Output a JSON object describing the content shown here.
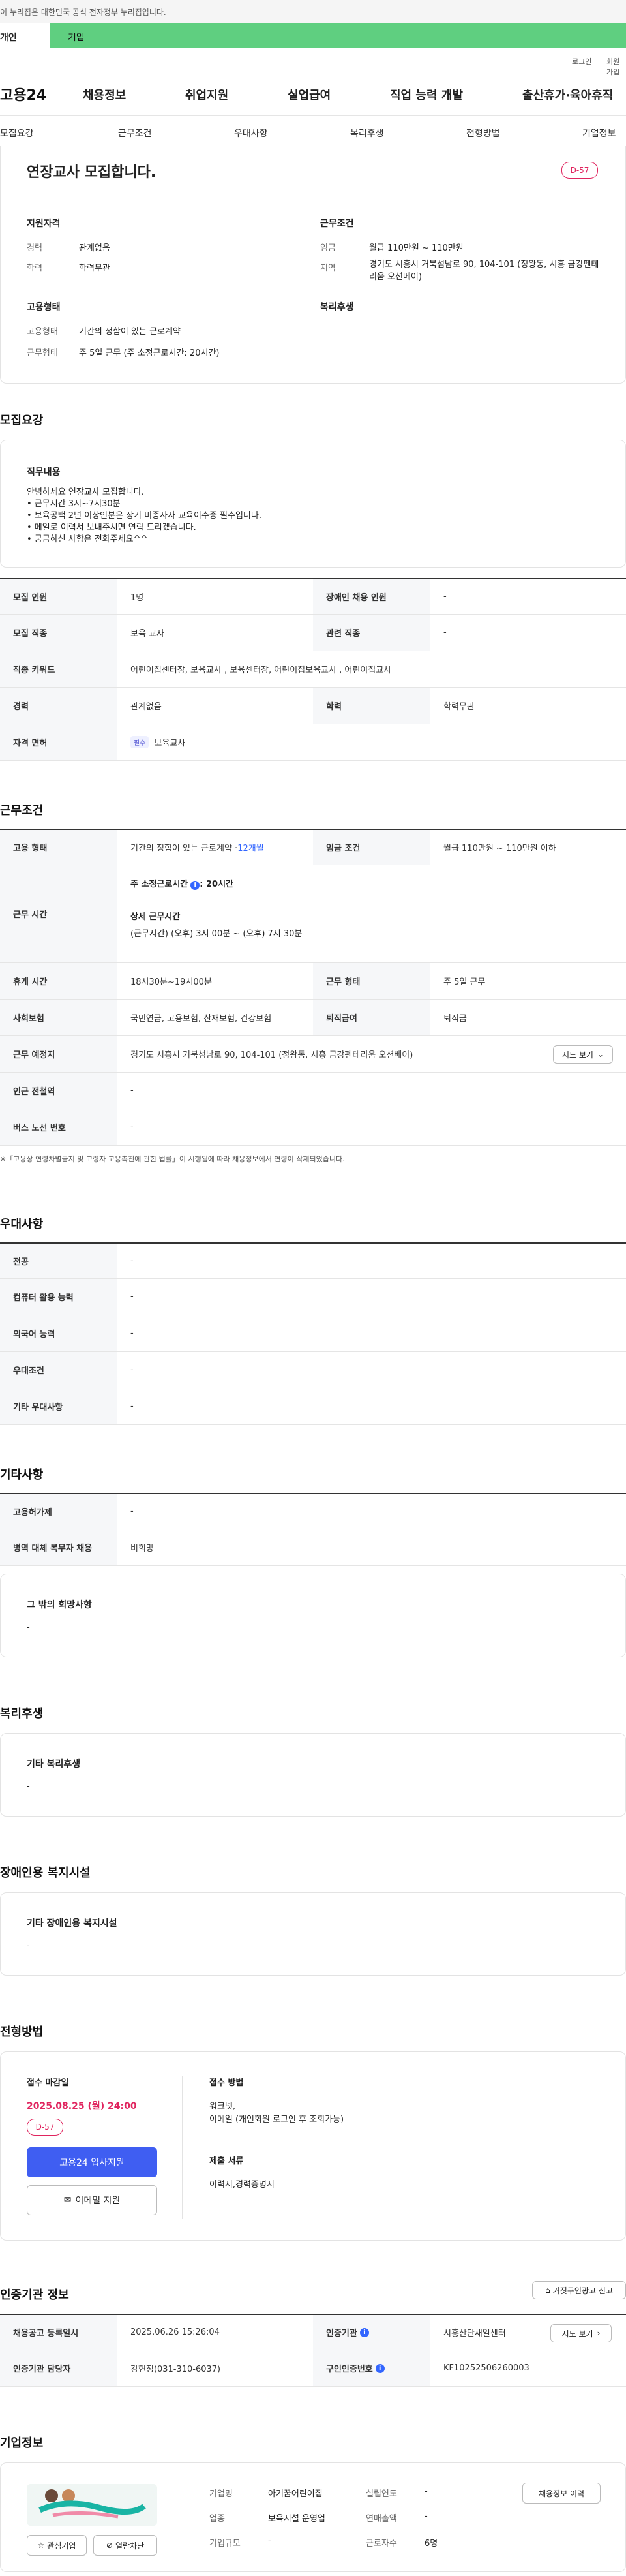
{
  "gov_notice": "이 누리집은 대한민국 공식 전자정부 누리집입니다.",
  "top_tabs": {
    "personal": "개인",
    "company": "기업"
  },
  "util": {
    "login": "로그인",
    "signup": "회원가입"
  },
  "logo": "고용24",
  "gnb": [
    "채용정보",
    "취업지원",
    "실업급여",
    "직업 능력 개발",
    "출산휴가·육아휴직"
  ],
  "snb": [
    "모집요강",
    "근무조건",
    "우대사항",
    "복리후생",
    "전형방법",
    "기업정보"
  ],
  "summary": {
    "title": "연장교사 모집합니다.",
    "dday": "D-57",
    "qual_title": "지원자격",
    "career_label": "경력",
    "career": "관계없음",
    "edu_label": "학력",
    "edu": "학력무관",
    "cond_title": "근무조건",
    "wage_label": "임금",
    "wage": "월급 110만원 ~ 110만원",
    "area_label": "지역",
    "area": "경기도 시흥시 거북섬남로 90, 104-101 (정왕동, 시흥 금강펜테리움 오션베이)",
    "emp_title": "고용형태",
    "emptype_label": "고용형태",
    "emptype": "기간의 정함이 있는 근로계약",
    "worktype_label": "근무형태",
    "worktype": "주 5일 근무 (주 소정근로시간: 20시간)",
    "welfare_title": "복리후생"
  },
  "recruit": {
    "title": "모집요강",
    "duty_title": "직무내용",
    "duty_lines": [
      "안녕하세요 연장교사 모집합니다.",
      "• 근무시간 3시~7시30분",
      "• 보육공백 2년 이상인분은 장기 미종사자 교육이수증 필수입니다.",
      "• 메일로 이력서 보내주시면 연락 드리겠습니다.",
      "• 궁금하신 사항은 전화주세요^^"
    ],
    "rows": [
      {
        "th": "모집 인원",
        "td": "1명",
        "th2": "장애인 채용 인원",
        "td2": "-"
      },
      {
        "th": "모집 직종",
        "td": "보육 교사",
        "th2": "관련 직종",
        "td2": "-"
      },
      {
        "th": "직종 키워드",
        "td": "어린이집센터장, 보육교사 , 보육센터장, 어린이집보육교사 , 어린이집교사"
      },
      {
        "th": "경력",
        "td": "관계없음",
        "th2": "학력",
        "td2": "학력무관"
      }
    ],
    "license_th": "자격 면허",
    "license_tag": "필수",
    "license": "보육교사"
  },
  "work": {
    "title": "근무조건",
    "emp_th": "고용 형태",
    "emp_td": "기간의 정함이 있는 근로계약 · ",
    "emp_months": "12개월",
    "wage_th": "임금 조건",
    "wage_td": "월급 110만원 ~ 110만원 이하",
    "hours_th": "근무 시간",
    "hours_main": "주 소정근로시간",
    "hours_val": ": 20시간",
    "hours_detail_title": "상세 근무시간",
    "hours_detail": "(근무시간) (오후) 3시 00분 ~ (오후) 7시 30분",
    "rest_th": "휴게 시간",
    "rest_td": "18시30분~19시00분",
    "type_th": "근무 형태",
    "type_td": "주 5일 근무",
    "ins_th": "사회보험",
    "ins_td": "국민연금, 고용보험, 산재보험, 건강보험",
    "sev_th": "퇴직급여",
    "sev_td": "퇴직금",
    "place_th": "근무 예정지",
    "place_td": "경기도 시흥시 거북섬남로 90, 104-101 (정왕동, 시흥 금강펜테리움 오션베이)",
    "map_btn": "지도 보기",
    "subway_th": "인근 전철역",
    "subway_td": "-",
    "bus_th": "버스 노선 번호",
    "bus_td": "-",
    "notice": "※「고용상 연령차별금지 및 고령자 고용촉진에 관한 법률」이 시행됨에 따라 채용정보에서 연령이 삭제되었습니다."
  },
  "pref": {
    "title": "우대사항",
    "rows": [
      [
        "전공",
        "-"
      ],
      [
        "컴퓨터 활용 능력",
        "-"
      ],
      [
        "외국어 능력",
        "-"
      ],
      [
        "우대조건",
        "-"
      ],
      [
        "기타 우대사항",
        "-"
      ]
    ]
  },
  "etc": {
    "title": "기타사항",
    "rows": [
      [
        "고용허가제",
        "-"
      ],
      [
        "병역 대체 복무자 채용",
        "비희망"
      ]
    ],
    "hope_title": "그 밖의 희망사항",
    "hope": "-"
  },
  "welfare": {
    "title": "복리후생",
    "box_title": "기타 복리후생",
    "box": "-"
  },
  "disabled": {
    "title": "장애인용 복지시설",
    "box_title": "기타 장애인용 복지시설",
    "box": "-"
  },
  "selection": {
    "title": "전형방법",
    "deadline_title": "접수 마감일",
    "deadline": "2025.08.25 (월) 24:00",
    "dday": "D-57",
    "apply_btn": "고용24 입사지원",
    "email_btn": "이메일 지원",
    "method_title": "접수 방법",
    "method_lines": [
      "워크넷,",
      "이메일 (개인회원 로그인 후 조회가능)"
    ],
    "docs_title": "제출 서류",
    "docs": "이력서,경력증명서"
  },
  "cert": {
    "title": "인증기관 정보",
    "report_btn": "거짓구인광고 신고",
    "reg_th": "채용공고 등록일시",
    "reg_td": "2025.06.26 15:26:04",
    "org_th": "인증기관",
    "org_td": "시흥산단새일센터",
    "map_btn": "지도 보기",
    "mgr_th": "인증기관 담당자",
    "mgr_td": "강현정(031-310-6037)",
    "no_th": "구인인증번호",
    "no_td": "KF10252506260003"
  },
  "company": {
    "title": "기업정보",
    "history_btn": "채용정보 이력",
    "fav_btn": "관심기업",
    "block_btn": "열람차단",
    "name_label": "기업명",
    "name": "아기꿈어린이집",
    "est_label": "설립연도",
    "est": "-",
    "industry_label": "업종",
    "industry": "보육시설 운영업",
    "sales_label": "연매출액",
    "sales": "-",
    "size_label": "기업규모",
    "size": "-",
    "emp_label": "근로자수",
    "emp": "6명"
  }
}
